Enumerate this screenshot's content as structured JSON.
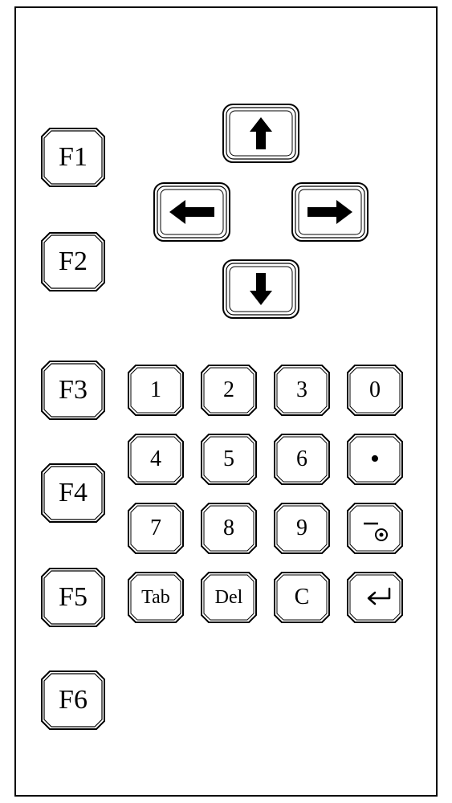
{
  "fkeys": {
    "f1": "F1",
    "f2": "F2",
    "f3": "F3",
    "f4": "F4",
    "f5": "F5",
    "f6": "F6"
  },
  "arrows": {
    "up": "up",
    "down": "down",
    "left": "left",
    "right": "right"
  },
  "numpad": {
    "r0": {
      "c0": "1",
      "c1": "2",
      "c2": "3",
      "c3": "0"
    },
    "r1": {
      "c0": "4",
      "c1": "5",
      "c2": "6",
      "c3": "•"
    },
    "r2": {
      "c0": "7",
      "c1": "8",
      "c2": "9",
      "c3": "-⊙"
    },
    "r3": {
      "c0": "Tab",
      "c1": "Del",
      "c2": "C",
      "c3": "↵"
    }
  }
}
